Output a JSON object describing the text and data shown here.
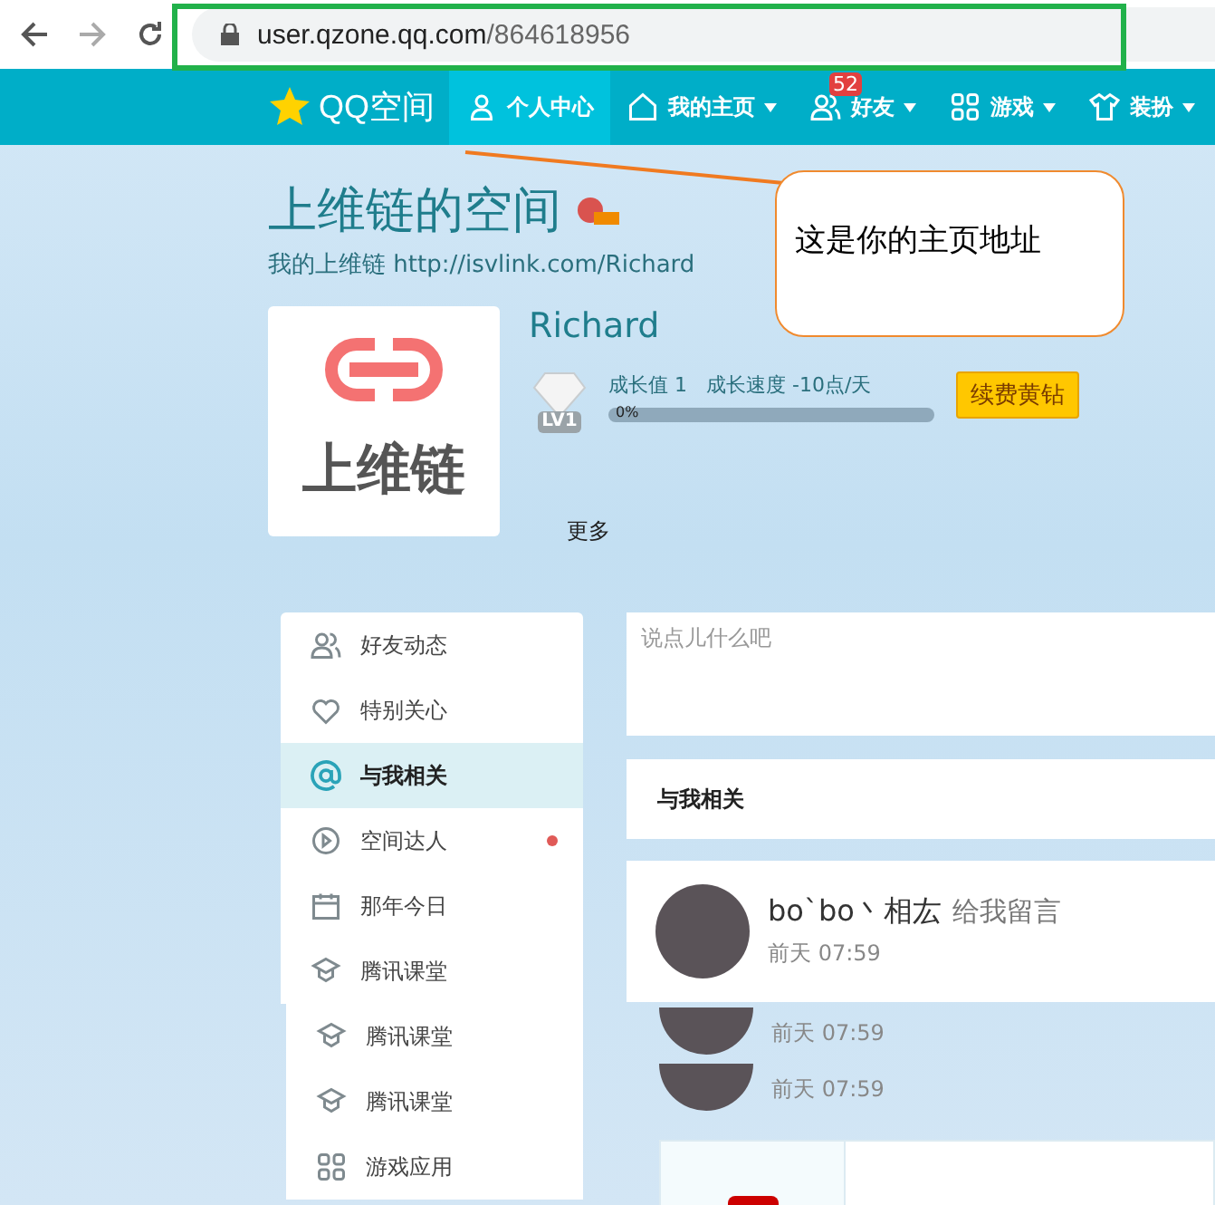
{
  "browser": {
    "url_host": "user.qzone.qq.com",
    "url_path": "/864618956"
  },
  "nav": {
    "logo": "QQ空间",
    "items": [
      {
        "label": "个人中心",
        "kind": "person",
        "selected": true,
        "dropdown": false
      },
      {
        "label": "我的主页",
        "kind": "home",
        "selected": false,
        "dropdown": true
      },
      {
        "label": "好友",
        "kind": "friends",
        "selected": false,
        "dropdown": true,
        "badge": "52"
      },
      {
        "label": "游戏",
        "kind": "grid",
        "selected": false,
        "dropdown": true
      },
      {
        "label": "装扮",
        "kind": "shirt",
        "selected": false,
        "dropdown": true
      }
    ]
  },
  "callout": {
    "text": "这是你的主页地址"
  },
  "profile": {
    "space_title": "上维链的空间",
    "link_text": "我的上维链 http://isvlink.com/Richard",
    "avatar_text": "上维链",
    "name": "Richard",
    "level_badge": "LV1",
    "growth": "成长值 1",
    "speed": "成长速度 -10点/天",
    "progress": {
      "level": 0,
      "label": "0%"
    },
    "renew_button": "续费黄钻",
    "more": "更多"
  },
  "sidebar": {
    "items": [
      {
        "label": "好友动态",
        "kind": "friends",
        "selected": false,
        "dot": false
      },
      {
        "label": "特别关心",
        "kind": "heart",
        "selected": false,
        "dot": false
      },
      {
        "label": "与我相关",
        "kind": "at",
        "selected": true,
        "dot": false
      },
      {
        "label": "空间达人",
        "kind": "play",
        "selected": false,
        "dot": true
      },
      {
        "label": "那年今日",
        "kind": "calendar",
        "selected": false,
        "dot": false
      },
      {
        "label": "腾讯课堂",
        "kind": "hat",
        "selected": false,
        "dot": false
      }
    ],
    "items_lower": [
      {
        "label": "腾讯课堂",
        "kind": "hat",
        "selected": false,
        "dot": false
      },
      {
        "label": "腾讯课堂",
        "kind": "hat",
        "selected": false,
        "dot": false
      },
      {
        "label": "游戏应用",
        "kind": "grid",
        "selected": false,
        "dot": false
      }
    ]
  },
  "composer": {
    "placeholder": "说点儿什么吧"
  },
  "section_title": "与我相关",
  "feed": {
    "user": "bo`bo丶相厷",
    "action": "给我留言",
    "time": "前天 07:59",
    "extra_times": [
      "前天 07:59",
      "前天 07:59"
    ]
  }
}
